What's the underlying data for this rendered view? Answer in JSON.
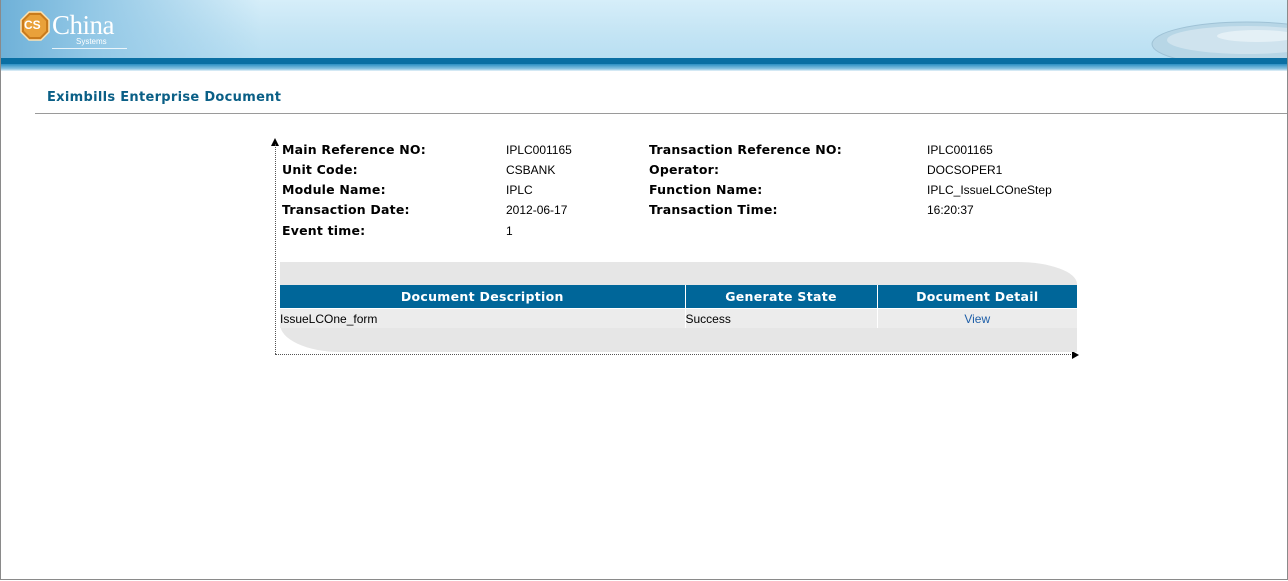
{
  "header": {
    "logo_badge": "CS",
    "logo_name": "China",
    "logo_sub": "Systems"
  },
  "page_title": "Eximbills Enterprise Document",
  "info": {
    "main_ref_label": "Main Reference NO:",
    "main_ref_value": "IPLC001165",
    "trx_ref_label": "Transaction Reference NO:",
    "trx_ref_value": "IPLC001165",
    "unit_code_label": "Unit Code:",
    "unit_code_value": "CSBANK",
    "operator_label": "Operator:",
    "operator_value": "DOCSOPER1",
    "module_label": "Module Name:",
    "module_value": "IPLC",
    "function_label": "Function Name:",
    "function_value": "IPLC_IssueLCOneStep",
    "trx_date_label": "Transaction Date:",
    "trx_date_value": "2012-06-17",
    "trx_time_label": "Transaction Time:",
    "trx_time_value": "16:20:37",
    "event_label": "Event time:",
    "event_value": "1"
  },
  "table": {
    "columns": [
      "Document Description",
      "Generate State",
      "Document Detail"
    ],
    "rows": [
      {
        "description": "IssueLCOne_form",
        "state": "Success",
        "detail": "View"
      }
    ]
  },
  "colors": {
    "header_blue": "#006699",
    "title_blue": "#0a5f86",
    "link_blue": "#1f5fa8",
    "panel_gray": "#e6e6e6"
  }
}
